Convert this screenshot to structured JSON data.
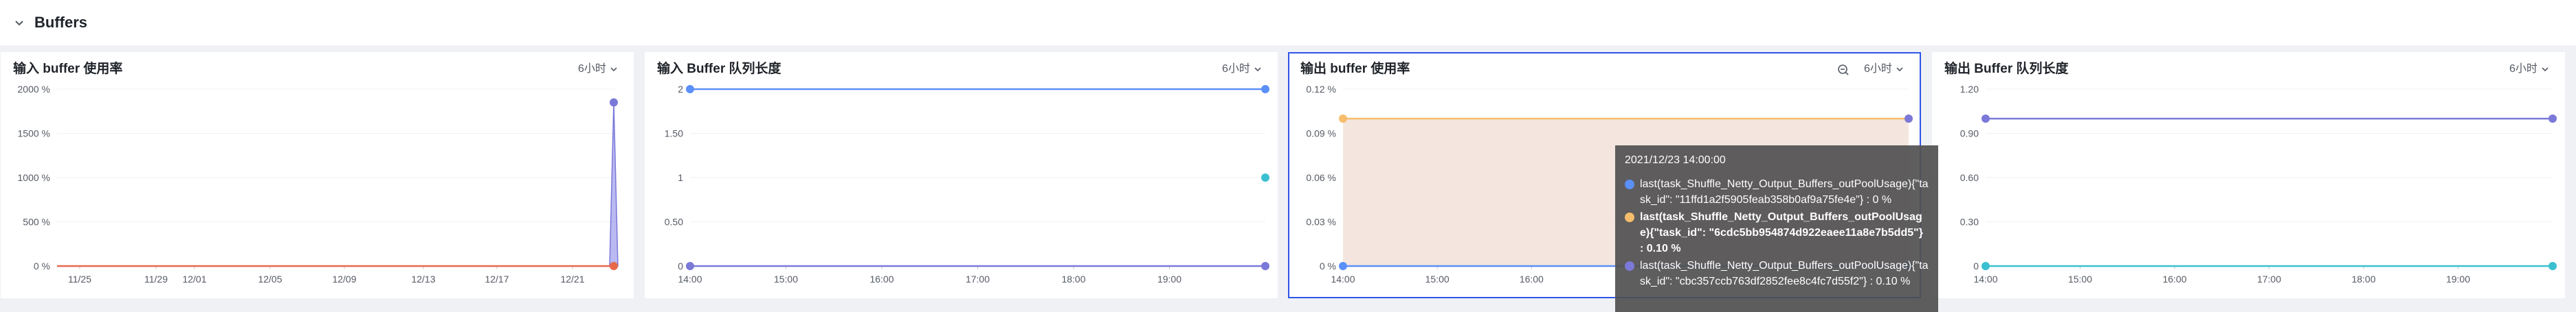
{
  "section": {
    "title": "Buffers"
  },
  "colors": {
    "blue": "#5b8ff9",
    "purple": "#7b79d8",
    "orange": "#f6bd6c",
    "red": "#e8684a",
    "cyan": "#3ac0d1",
    "area_orange": "#f3e3da",
    "area_purple": "#a9a8ee",
    "active_border": "#2f54eb"
  },
  "panels": [
    {
      "title": "输入 buffer 使用率",
      "range": "6小时",
      "active": false
    },
    {
      "title": "输入 Buffer 队列长度",
      "range": "6小时",
      "active": false
    },
    {
      "title": "输出 buffer 使用率",
      "range": "6小时",
      "active": true,
      "zoom_icon": "zoom-out-icon"
    },
    {
      "title": "输出 Buffer 队列长度",
      "range": "6小时",
      "active": false
    }
  ],
  "chart_data": [
    {
      "type": "area",
      "title": "输入 buffer 使用率",
      "x_ticks": [
        "11/25",
        "11/29",
        "12/01",
        "12/05",
        "12/09",
        "12/13",
        "12/17",
        "12/21"
      ],
      "y_ticks": [
        "0 %",
        "500 %",
        "1000 %",
        "1500 %",
        "2000 %"
      ],
      "ylim": [
        0,
        2000
      ],
      "series": [
        {
          "color": "#7b79d8",
          "points": [
            [
              "11/25",
              0
            ],
            [
              "12/23",
              0
            ],
            [
              "12/23",
              1850
            ],
            [
              "12/23",
              0
            ]
          ]
        },
        {
          "color": "#e8684a",
          "points": [
            [
              "11/25",
              0
            ],
            [
              "12/23",
              0
            ]
          ]
        }
      ]
    },
    {
      "type": "line",
      "title": "输入 Buffer 队列长度",
      "x_ticks": [
        "14:00",
        "15:00",
        "16:00",
        "17:00",
        "18:00",
        "19:00"
      ],
      "y_ticks": [
        "0",
        "0.50",
        "1",
        "1.50",
        "2"
      ],
      "ylim": [
        0,
        2
      ],
      "series": [
        {
          "color": "#5b8ff9",
          "points": [
            [
              "14:00",
              2
            ],
            [
              "20:00",
              2
            ]
          ]
        },
        {
          "color": "#7b79d8",
          "points": [
            [
              "14:00",
              0
            ],
            [
              "20:00",
              0
            ]
          ]
        },
        {
          "color": "#3ac0d1",
          "points": [
            [
              "20:00",
              1
            ]
          ]
        }
      ]
    },
    {
      "type": "area",
      "title": "输出 buffer 使用率",
      "x_ticks": [
        "14:00",
        "15:00",
        "16:00"
      ],
      "y_ticks": [
        "0 %",
        "0.03 %",
        "0.06 %",
        "0.09 %",
        "0.12 %"
      ],
      "ylim": [
        0,
        0.12
      ],
      "series": [
        {
          "color": "#f6bd6c",
          "points": [
            [
              "14:00",
              0.1
            ],
            [
              "20:00",
              0.1
            ]
          ]
        },
        {
          "color": "#5b8ff9",
          "points": [
            [
              "14:00",
              0
            ],
            [
              "20:00",
              0
            ]
          ]
        },
        {
          "color": "#7b79d8",
          "points": [
            [
              "20:00",
              0.1
            ]
          ]
        }
      ]
    },
    {
      "type": "line",
      "title": "输出 Buffer 队列长度",
      "x_ticks": [
        "14:00",
        "15:00",
        "16:00",
        "17:00",
        "18:00",
        "19:00"
      ],
      "y_ticks": [
        "0",
        "0.30",
        "0.60",
        "0.90",
        "1.20"
      ],
      "ylim": [
        0,
        1.2
      ],
      "series": [
        {
          "color": "#7b79d8",
          "points": [
            [
              "14:00",
              1
            ],
            [
              "20:00",
              1
            ]
          ]
        },
        {
          "color": "#3ac0d1",
          "points": [
            [
              "14:00",
              0
            ],
            [
              "20:00",
              0
            ]
          ]
        }
      ]
    }
  ],
  "tooltip": {
    "time": "2021/12/23 14:00:00",
    "rows": [
      {
        "color": "#5b8ff9",
        "highlight": false,
        "text": "last(task_Shuffle_Netty_Output_Buffers_outPoolUsage){\"task_id\": \"11ffd1a2f5905feab358b0af9a75fe4e\"} : 0 %"
      },
      {
        "color": "#f6bd6c",
        "highlight": true,
        "text": "last(task_Shuffle_Netty_Output_Buffers_outPoolUsage){\"task_id\": \"6cdc5bb954874d922eaee11a8e7b5dd5\"} : 0.10 %"
      },
      {
        "color": "#7b79d8",
        "highlight": false,
        "text": "last(task_Shuffle_Netty_Output_Buffers_outPoolUsage){\"task_id\": \"cbc357ccb763df2852fee8c4fc7d55f2\"} : 0.10 %"
      }
    ]
  }
}
